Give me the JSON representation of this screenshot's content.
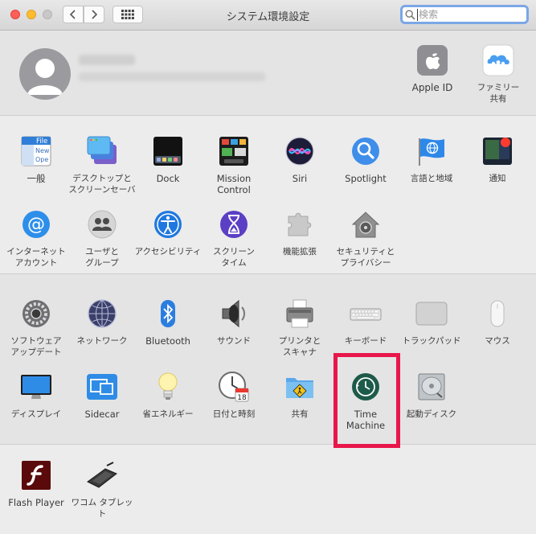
{
  "window": {
    "title": "システム環境設定"
  },
  "search": {
    "placeholder": "検索"
  },
  "account": {
    "apple_id": "Apple ID",
    "family": "ファミリー\n共有"
  },
  "section1": {
    "general": "一般",
    "desktop": "デスクトップと\nスクリーンセーバ",
    "dock": "Dock",
    "mission": "Mission\nControl",
    "siri": "Siri",
    "spotlight": "Spotlight",
    "language": "言語と地域",
    "notifications": "通知",
    "internet": "インターネット\nアカウント",
    "users": "ユーザと\nグループ",
    "accessibility": "アクセシビリティ",
    "screentime": "スクリーン\nタイム",
    "extensions": "機能拡張",
    "security": "セキュリティと\nプライバシー"
  },
  "section2": {
    "software": "ソフトウェア\nアップデート",
    "network": "ネットワーク",
    "bluetooth": "Bluetooth",
    "sound": "サウンド",
    "printers": "プリンタと\nスキャナ",
    "keyboard": "キーボード",
    "trackpad": "トラックパッド",
    "mouse": "マウス",
    "displays": "ディスプレイ",
    "sidecar": "Sidecar",
    "energy": "省エネルギー",
    "datetime": "日付と時刻",
    "sharing": "共有",
    "timemachine": "Time\nMachine",
    "startup": "起動ディスク"
  },
  "section3": {
    "flash": "Flash Player",
    "wacom": "ワコム タブレット"
  },
  "icon_text": {
    "file_line1": "File",
    "file_line2": "New",
    "file_line3": "Ope",
    "calendar_day": "18"
  }
}
